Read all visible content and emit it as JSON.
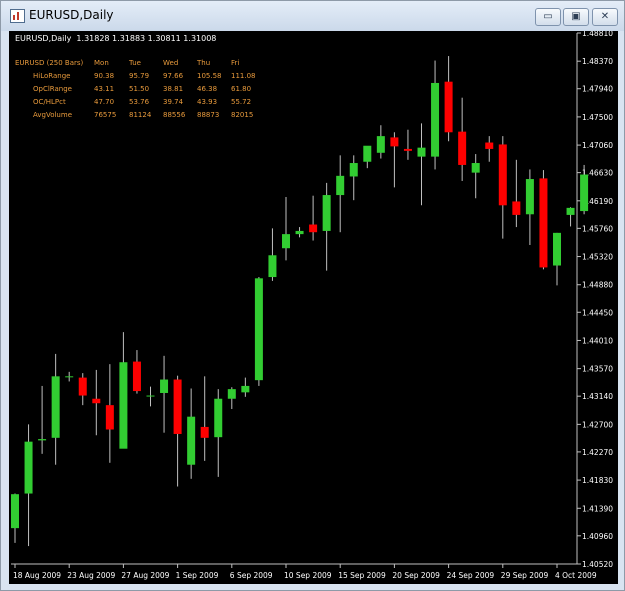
{
  "window": {
    "title": "EURUSD,Daily",
    "buttons": [
      {
        "name": "minimize-button",
        "glyph": "▭"
      },
      {
        "name": "maximize-button",
        "glyph": "▣"
      },
      {
        "name": "close-button",
        "glyph": "✕"
      }
    ]
  },
  "chart": {
    "symbol_line": "EURUSD,Daily  1.31828 1.31883 1.30811 1.31008",
    "stats": {
      "title": "EURUSD (250 Bars)",
      "columns": [
        "Mon",
        "Tue",
        "Wed",
        "Thu",
        "Fri"
      ],
      "rows": [
        {
          "label": "HiLoRange",
          "values": [
            "90.38",
            "95.79",
            "97.66",
            "105.58",
            "111.08"
          ]
        },
        {
          "label": "OpClRange",
          "values": [
            "43.11",
            "51.50",
            "38.81",
            "46.38",
            "61.80"
          ]
        },
        {
          "label": "OC/HLPct",
          "values": [
            "47.70",
            "53.76",
            "39.74",
            "43.93",
            "55.72"
          ]
        },
        {
          "label": "AvgVolume",
          "values": [
            "76575",
            "81124",
            "88556",
            "88873",
            "82015"
          ]
        }
      ]
    },
    "colors": {
      "background": "#000000",
      "bull": "#32cd32",
      "bear": "#ff0000",
      "wick": "#c0c0c0",
      "axis": "#c0c0c0",
      "stats_text": "#e89a3c"
    }
  },
  "chart_data": {
    "type": "candlestick",
    "ylim": [
      1.4052,
      1.4881
    ],
    "y_ticks": [
      "1.48810",
      "1.48370",
      "1.47940",
      "1.47500",
      "1.47060",
      "1.46630",
      "1.46190",
      "1.45760",
      "1.45320",
      "1.44880",
      "1.44450",
      "1.44010",
      "1.43570",
      "1.43140",
      "1.42700",
      "1.42270",
      "1.41830",
      "1.41390",
      "1.40960",
      "1.40520"
    ],
    "x_ticks": [
      {
        "label": "18 Aug 2009",
        "bar": 0
      },
      {
        "label": "23 Aug 2009",
        "bar": 4
      },
      {
        "label": "27 Aug 2009",
        "bar": 8
      },
      {
        "label": "1 Sep 2009",
        "bar": 12
      },
      {
        "label": "6 Sep 2009",
        "bar": 16
      },
      {
        "label": "10 Sep 2009",
        "bar": 20
      },
      {
        "label": "15 Sep 2009",
        "bar": 24
      },
      {
        "label": "20 Sep 2009",
        "bar": 28
      },
      {
        "label": "24 Sep 2009",
        "bar": 32
      },
      {
        "label": "29 Sep 2009",
        "bar": 36
      },
      {
        "label": "4 Oct 2009",
        "bar": 40
      }
    ],
    "candles": [
      {
        "o": 1.4108,
        "h": 1.4162,
        "l": 1.4085,
        "c": 1.4161
      },
      {
        "o": 1.4162,
        "h": 1.427,
        "l": 1.408,
        "c": 1.4243
      },
      {
        "o": 1.4245,
        "h": 1.433,
        "l": 1.4224,
        "c": 1.4247
      },
      {
        "o": 1.4249,
        "h": 1.438,
        "l": 1.4207,
        "c": 1.4345
      },
      {
        "o": 1.4345,
        "h": 1.4352,
        "l": 1.4337,
        "c": 1.4345
      },
      {
        "o": 1.4343,
        "h": 1.435,
        "l": 1.43,
        "c": 1.4315
      },
      {
        "o": 1.431,
        "h": 1.4355,
        "l": 1.4253,
        "c": 1.4303
      },
      {
        "o": 1.43,
        "h": 1.4364,
        "l": 1.421,
        "c": 1.4262
      },
      {
        "o": 1.4232,
        "h": 1.4414,
        "l": 1.4233,
        "c": 1.4367
      },
      {
        "o": 1.4368,
        "h": 1.4386,
        "l": 1.4318,
        "c": 1.4322
      },
      {
        "o": 1.4315,
        "h": 1.4329,
        "l": 1.4298,
        "c": 1.4315
      },
      {
        "o": 1.4319,
        "h": 1.4377,
        "l": 1.4257,
        "c": 1.434
      },
      {
        "o": 1.434,
        "h": 1.4346,
        "l": 1.4173,
        "c": 1.4255
      },
      {
        "o": 1.4207,
        "h": 1.4326,
        "l": 1.4185,
        "c": 1.4282
      },
      {
        "o": 1.4266,
        "h": 1.4345,
        "l": 1.4213,
        "c": 1.4249
      },
      {
        "o": 1.425,
        "h": 1.4325,
        "l": 1.4188,
        "c": 1.431
      },
      {
        "o": 1.431,
        "h": 1.4328,
        "l": 1.4294,
        "c": 1.4325
      },
      {
        "o": 1.432,
        "h": 1.4343,
        "l": 1.4313,
        "c": 1.433
      },
      {
        "o": 1.4339,
        "h": 1.45,
        "l": 1.433,
        "c": 1.4498
      },
      {
        "o": 1.45,
        "h": 1.4576,
        "l": 1.4494,
        "c": 1.4534
      },
      {
        "o": 1.4545,
        "h": 1.4625,
        "l": 1.4526,
        "c": 1.4567
      },
      {
        "o": 1.4567,
        "h": 1.4578,
        "l": 1.4562,
        "c": 1.4572
      },
      {
        "o": 1.4582,
        "h": 1.4627,
        "l": 1.4557,
        "c": 1.457
      },
      {
        "o": 1.4572,
        "h": 1.4647,
        "l": 1.451,
        "c": 1.4628
      },
      {
        "o": 1.4628,
        "h": 1.469,
        "l": 1.457,
        "c": 1.4658
      },
      {
        "o": 1.4657,
        "h": 1.469,
        "l": 1.462,
        "c": 1.4678
      },
      {
        "o": 1.468,
        "h": 1.47,
        "l": 1.467,
        "c": 1.4705
      },
      {
        "o": 1.4694,
        "h": 1.4737,
        "l": 1.4685,
        "c": 1.472
      },
      {
        "o": 1.4718,
        "h": 1.4726,
        "l": 1.464,
        "c": 1.4704
      },
      {
        "o": 1.47,
        "h": 1.473,
        "l": 1.4683,
        "c": 1.4697
      },
      {
        "o": 1.4688,
        "h": 1.474,
        "l": 1.4612,
        "c": 1.4702
      },
      {
        "o": 1.4688,
        "h": 1.4838,
        "l": 1.4668,
        "c": 1.4803
      },
      {
        "o": 1.4805,
        "h": 1.4845,
        "l": 1.4712,
        "c": 1.4726
      },
      {
        "o": 1.4727,
        "h": 1.478,
        "l": 1.465,
        "c": 1.4675
      },
      {
        "o": 1.4663,
        "h": 1.4692,
        "l": 1.4623,
        "c": 1.4678
      },
      {
        "o": 1.471,
        "h": 1.472,
        "l": 1.468,
        "c": 1.47
      },
      {
        "o": 1.4707,
        "h": 1.472,
        "l": 1.456,
        "c": 1.4612
      },
      {
        "o": 1.4618,
        "h": 1.4683,
        "l": 1.4578,
        "c": 1.4597
      },
      {
        "o": 1.4598,
        "h": 1.4668,
        "l": 1.455,
        "c": 1.4653
      },
      {
        "o": 1.4654,
        "h": 1.4667,
        "l": 1.4512,
        "c": 1.4515
      },
      {
        "o": 1.4518,
        "h": 1.4569,
        "l": 1.4487,
        "c": 1.4569
      },
      {
        "o": 1.4597,
        "h": 1.4609,
        "l": 1.4579,
        "c": 1.4608
      },
      {
        "o": 1.4603,
        "h": 1.4675,
        "l": 1.4598,
        "c": 1.466
      }
    ]
  }
}
